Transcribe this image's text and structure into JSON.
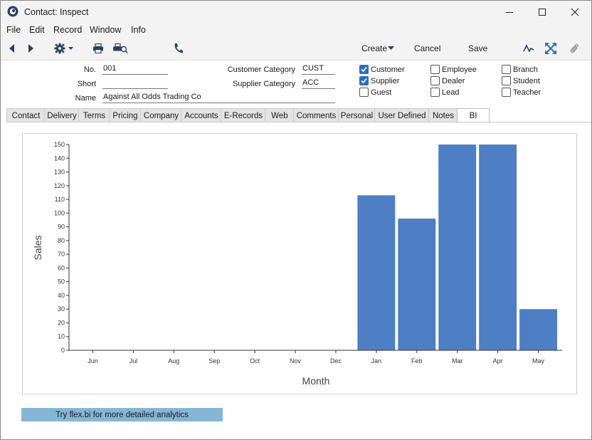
{
  "window": {
    "title": "Contact: Inspect"
  },
  "menu": {
    "items": [
      "File",
      "Edit",
      "Record",
      "Window",
      "Info"
    ]
  },
  "toolbar": {
    "create_label": "Create",
    "cancel_label": "Cancel",
    "save_label": "Save"
  },
  "header": {
    "no_label": "No.",
    "no_value": "001",
    "short_label": "Short",
    "short_value": "",
    "name_label": "Name",
    "name_value": "Against All Odds Trading Co",
    "customer_category_label": "Customer Category",
    "customer_category_value": "CUST",
    "supplier_category_label": "Supplier Category",
    "supplier_category_value": "ACC"
  },
  "checkboxes": [
    {
      "label": "Customer",
      "checked": true
    },
    {
      "label": "Supplier",
      "checked": true
    },
    {
      "label": "Guest",
      "checked": false
    },
    {
      "label": "Employee",
      "checked": false
    },
    {
      "label": "Dealer",
      "checked": false
    },
    {
      "label": "Lead",
      "checked": false
    },
    {
      "label": "Branch",
      "checked": false
    },
    {
      "label": "Student",
      "checked": false
    },
    {
      "label": "Teacher",
      "checked": false
    }
  ],
  "tabs": [
    "Contact",
    "Delivery",
    "Terms",
    "Pricing",
    "Company",
    "Accounts",
    "E-Records",
    "Web",
    "Comments",
    "Personal",
    "User Defined",
    "Notes",
    "BI"
  ],
  "active_tab": "BI",
  "chart_data": {
    "type": "bar",
    "categories": [
      "Jun",
      "Jul",
      "Aug",
      "Sep",
      "Oct",
      "Nov",
      "Dec",
      "Jan",
      "Feb",
      "Mar",
      "Apr",
      "May"
    ],
    "values": [
      0,
      0,
      0,
      0,
      0,
      0,
      0,
      113,
      96,
      150,
      150,
      30
    ],
    "xlabel": "Month",
    "ylabel": "Sales",
    "ylim": [
      0,
      150
    ],
    "yticks": [
      0,
      10,
      20,
      30,
      40,
      50,
      60,
      70,
      80,
      90,
      100,
      110,
      120,
      130,
      140,
      150
    ],
    "bar_color": "#4e7ec4",
    "grid": false
  },
  "footer": {
    "flexbi_label": "Try flex.bi for more detailed analytics"
  },
  "colors": {
    "accent": "#2f6fba",
    "bar": "#4e7ec4",
    "flexbi_bg": "#86b6d6"
  }
}
